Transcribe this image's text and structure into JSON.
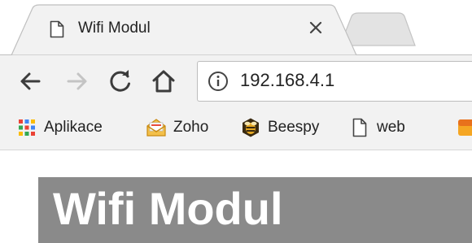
{
  "browser": {
    "tab": {
      "title": "Wifi Modul",
      "icon": "page-icon",
      "close_icon": "close-icon"
    },
    "new_tab_icon": "new-tab-icon",
    "nav": {
      "back_icon": "back-arrow-icon",
      "forward_icon": "forward-arrow-icon",
      "reload_icon": "reload-icon",
      "home_icon": "home-icon"
    },
    "address": {
      "url": "192.168.4.1",
      "icon": "info-icon"
    },
    "bookmarks": [
      {
        "label": "Aplikace",
        "icon": "apps-grid-icon"
      },
      {
        "label": "Zoho",
        "icon": "envelope-icon"
      },
      {
        "label": "Beespy",
        "icon": "bee-icon"
      },
      {
        "label": "web",
        "icon": "page-icon"
      },
      {
        "label": "",
        "icon": "bookmark-icon"
      }
    ]
  },
  "page": {
    "heading": "Wifi Modul"
  },
  "colors": {
    "toolbar_bg": "#f2f2f2",
    "heading_bar": "#8a8a8a",
    "heading_text": "#ffffff",
    "apps_red": "#ea4335",
    "apps_blue": "#4285f4",
    "apps_yellow": "#fbbc05",
    "apps_green": "#34a853"
  }
}
